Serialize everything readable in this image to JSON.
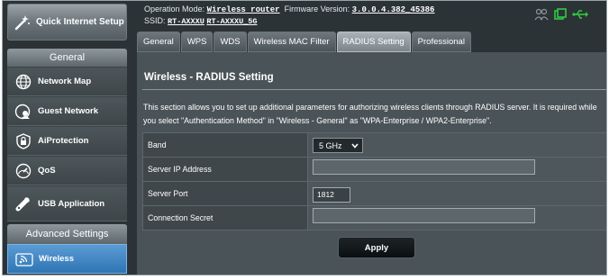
{
  "sidebar": {
    "quick_setup": "Quick Internet Setup",
    "general_header": "General",
    "general_items": [
      {
        "label": "Network Map",
        "icon": "globe-icon"
      },
      {
        "label": "Guest Network",
        "icon": "guest-network-icon"
      },
      {
        "label": "AiProtection",
        "icon": "lock-icon"
      },
      {
        "label": "QoS",
        "icon": "gauge-icon"
      },
      {
        "label": "USB Application",
        "icon": "usb-icon"
      }
    ],
    "advanced_header": "Advanced Settings",
    "advanced_items": [
      {
        "label": "Wireless",
        "icon": "wifi-icon",
        "active": true
      }
    ]
  },
  "header": {
    "op_mode_label": "Operation Mode:",
    "op_mode_value": "Wireless router",
    "fw_label": "Firmware Version:",
    "fw_value": "3.0.0.4.382_45386",
    "ssid_label": "SSID:",
    "ssid_1": "RT-AXXXU",
    "ssid_2": "RT-AXXXU_5G",
    "status_icons": [
      "users-icon",
      "network-status-icon",
      "usb-status-icon"
    ]
  },
  "tabs": [
    {
      "label": "General"
    },
    {
      "label": "WPS"
    },
    {
      "label": "WDS"
    },
    {
      "label": "Wireless MAC Filter"
    },
    {
      "label": "RADIUS Setting",
      "active": true
    },
    {
      "label": "Professional"
    }
  ],
  "page": {
    "title": "Wireless - RADIUS Setting",
    "description": "This section allows you to set up additional parameters for authorizing wireless clients through RADIUS server. It is required while you select \"Authentication Method\" in \"Wireless - General\" as \"WPA-Enterprise / WPA2-Enterprise\"."
  },
  "form": {
    "band_label": "Band",
    "band_value": "5 GHz",
    "server_ip_label": "Server IP Address",
    "server_ip_value": "",
    "server_port_label": "Server Port",
    "server_port_value": "1812",
    "secret_label": "Connection Secret",
    "secret_value": ""
  },
  "apply_label": "Apply",
  "colors": {
    "accent": "#2f75b5",
    "background": "#2b3337",
    "panel": "#4a5357"
  }
}
